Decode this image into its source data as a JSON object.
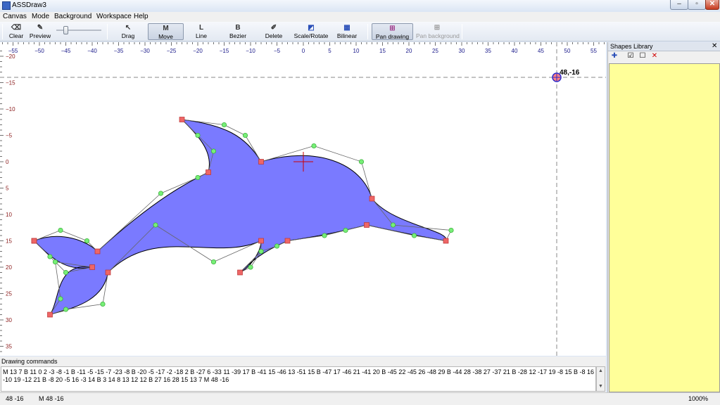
{
  "window": {
    "title": "ASSDraw3",
    "minimize": "–",
    "maximize": "▫",
    "close": "✕"
  },
  "menu": [
    "Canvas",
    "Mode",
    "Background",
    "Workspace",
    "Help"
  ],
  "toolbar": [
    {
      "id": "clear",
      "label": "Clear",
      "icon": "eraser-icon",
      "glyph": "⌫",
      "active": false,
      "enabled": true
    },
    {
      "id": "preview",
      "label": "Preview",
      "icon": "preview-icon",
      "glyph": "✎",
      "active": false,
      "enabled": true
    },
    {
      "id": "drag",
      "label": "Drag",
      "icon": "drag-cursor-icon",
      "glyph": "↖",
      "active": false,
      "enabled": true
    },
    {
      "id": "move",
      "label": "Move",
      "icon": "move-m-icon",
      "glyph": "M",
      "active": true,
      "enabled": true
    },
    {
      "id": "line",
      "label": "Line",
      "icon": "line-l-icon",
      "glyph": "L",
      "active": false,
      "enabled": true
    },
    {
      "id": "bezier",
      "label": "Bezier",
      "icon": "bezier-b-icon",
      "glyph": "B",
      "active": false,
      "enabled": true
    },
    {
      "id": "delete",
      "label": "Delete",
      "icon": "delete-pen-icon",
      "glyph": "✐",
      "active": false,
      "enabled": true
    },
    {
      "id": "scale-rotate",
      "label": "Scale/Rotate",
      "icon": "scale-rotate-icon",
      "glyph": "◩",
      "active": false,
      "enabled": true
    },
    {
      "id": "bilinear",
      "label": "Bilinear",
      "icon": "bilinear-icon",
      "glyph": "▦",
      "active": false,
      "enabled": true
    },
    {
      "id": "pan-drawing",
      "label": "Pan drawing",
      "icon": "pan-drawing-icon",
      "glyph": "⊞",
      "active": true,
      "enabled": true
    },
    {
      "id": "pan-background",
      "label": "Pan background",
      "icon": "pan-background-icon",
      "glyph": "⊞",
      "active": false,
      "enabled": false
    }
  ],
  "ruler": {
    "x_ticks": [
      -55,
      -50,
      -45,
      -40,
      -35,
      -30,
      -25,
      -20,
      -15,
      -10,
      -5,
      0,
      5,
      10,
      15,
      20,
      25,
      30,
      35,
      40,
      45,
      50,
      55
    ],
    "y_ticks": [
      -20,
      -15,
      -10,
      -5,
      0,
      5,
      10,
      15,
      20,
      25,
      30,
      35
    ]
  },
  "cursor": {
    "label": "48,-16",
    "x": 48,
    "y": -16
  },
  "shape": {
    "fill": "#7a7aff",
    "origin_mark": [
      0,
      0
    ],
    "segments": [
      {
        "t": "M",
        "p": [
          [
            -51,
            15
          ]
        ]
      },
      {
        "t": "B",
        "p": [
          [
            -46,
            13
          ],
          [
            -41,
            15
          ],
          [
            -39,
            17
          ]
        ]
      },
      {
        "t": "B",
        "p": [
          [
            -27,
            6
          ],
          [
            -20,
            3
          ],
          [
            -18,
            2
          ]
        ]
      },
      {
        "t": "B",
        "p": [
          [
            -17,
            -2
          ],
          [
            -20,
            -5
          ],
          [
            -23,
            -8
          ]
        ]
      },
      {
        "t": "B",
        "p": [
          [
            -15,
            -7
          ],
          [
            -11,
            -5
          ],
          [
            -8,
            0
          ]
        ]
      },
      {
        "t": "B",
        "p": [
          [
            2,
            -3
          ],
          [
            11,
            0
          ],
          [
            13,
            7
          ]
        ]
      },
      {
        "t": "B",
        "p": [
          [
            17,
            12
          ],
          [
            28,
            13
          ],
          [
            27,
            15
          ]
        ]
      },
      {
        "t": "B",
        "p": [
          [
            21,
            14
          ],
          [
            12,
            12
          ],
          [
            12,
            12
          ]
        ]
      },
      {
        "t": "B",
        "p": [
          [
            8,
            13
          ],
          [
            4,
            14
          ],
          [
            -3,
            15
          ]
        ]
      },
      {
        "t": "B",
        "p": [
          [
            -5,
            16
          ],
          [
            -8,
            17
          ],
          [
            -12,
            21
          ]
        ]
      },
      {
        "t": "B",
        "p": [
          [
            -10,
            20
          ],
          [
            -8,
            17
          ],
          [
            -8,
            15
          ]
        ]
      },
      {
        "t": "B",
        "p": [
          [
            -17,
            19
          ],
          [
            -28,
            12
          ],
          [
            -37,
            21
          ]
        ]
      },
      {
        "t": "B",
        "p": [
          [
            -38,
            27
          ],
          [
            -45,
            28
          ],
          [
            -48,
            29
          ]
        ]
      },
      {
        "t": "B",
        "p": [
          [
            -46,
            26
          ],
          [
            -47,
            19
          ],
          [
            -40,
            20
          ]
        ]
      },
      {
        "t": "B",
        "p": [
          [
            -45,
            21
          ],
          [
            -48,
            18
          ],
          [
            -51,
            15
          ]
        ]
      }
    ]
  },
  "panel": {
    "title": "Shapes Library",
    "close": "✕",
    "tools": [
      {
        "name": "add-shape-icon",
        "glyph": "✚",
        "color": "#2a4fb8"
      },
      {
        "name": "check-all-icon",
        "glyph": "☑",
        "color": "#000"
      },
      {
        "name": "uncheck-all-icon",
        "glyph": "☐",
        "color": "#000"
      },
      {
        "name": "delete-shape-icon",
        "glyph": "✕",
        "color": "#d00000"
      }
    ]
  },
  "commands": {
    "label": "Drawing commands",
    "text": "M 13 7 B 11 0 2 -3 -8 -1 B -11 -5 -15 -7 -23 -8 B -20 -5 -17 -2 -18 2 B -27 6 -33 11 -39 17 B -41 15 -46 13 -51 15 B -47 17 -46 21 -41 20 B -45 22 -45 26 -48 29 B -44 28 -38 27 -37 21 B -28 12 -17 19 -8 15 B -8 16 -10 19 -12 21 B -8 20 -5 16 -3 14 B 3 14 8 13 12 12 B 27 16 28 15 13 7 M 48 -16"
  },
  "status": {
    "coords": "48  -16",
    "last": "M 48 -16",
    "zoom": "1000%"
  }
}
